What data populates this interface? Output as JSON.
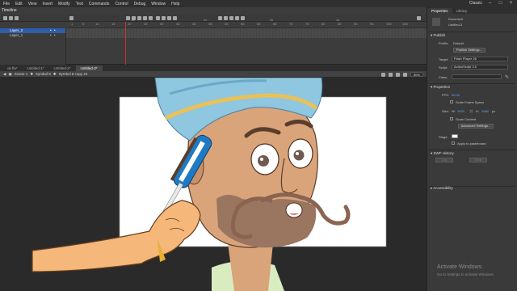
{
  "menu": {
    "items": [
      "File",
      "Edit",
      "View",
      "Insert",
      "Modify",
      "Text",
      "Commands",
      "Control",
      "Debug",
      "Window",
      "Help"
    ],
    "workspace": "Classic"
  },
  "timeline": {
    "title": "Timeline",
    "ruler_ticks": [
      "1",
      "5",
      "10",
      "15",
      "20",
      "25",
      "30",
      "35",
      "40",
      "45",
      "50",
      "55",
      "60",
      "65",
      "70",
      "75",
      "80",
      "85",
      "90",
      "95",
      "100",
      "105"
    ],
    "ruler_seconds": [
      "1s",
      "2s",
      "3s",
      "4s"
    ],
    "layers": [
      {
        "name": "Layer_2",
        "selected": true
      },
      {
        "name": "Layer_1",
        "selected": false
      }
    ],
    "current_frame": 23
  },
  "document_tabs": [
    "ok.fla*",
    "Untitled-1*",
    "Untitled-2*",
    "Untitled-3*"
  ],
  "active_tab_index": 3,
  "edit_bar": {
    "scene": "Scene 1",
    "symbol1": "Symbol 8",
    "symbol2": "Symbol 8 copy 22",
    "zoom": "50%"
  },
  "properties": {
    "tabs": [
      "Properties",
      "Library"
    ],
    "doc_type": "Document",
    "doc_name": "Untitled-3",
    "publish_section": "Publish",
    "profile_label": "Profile:",
    "profile_value": "Default",
    "publish_settings_button": "Publish Settings...",
    "target_label": "Target:",
    "target_value": "Flash Player 26",
    "script_label": "Script:",
    "script_value": "ActionScript 3.0",
    "class_label": "Class:",
    "props_section": "Properties",
    "fps_label": "FPS:",
    "fps_value": "30.00",
    "scale_frame_spans": "Scale Frame Spans",
    "size_label": "Size:",
    "size_w_label": "W:",
    "size_w": "1920",
    "size_h_label": "H:",
    "size_h": "1080",
    "size_unit": "px",
    "scale_content": "Scale Content",
    "advanced_settings": "Advanced Settings...",
    "stage_label": "Stage:",
    "apply_pasteboard": "Apply to pasteboard",
    "swf_history": "SWF History",
    "log_button": "Log",
    "clear_button": "Clear",
    "accessibility": "Accessibility"
  },
  "watermark": {
    "title": "Activate Windows",
    "subtitle": "Go to Settings to activate Windows."
  },
  "colors": {
    "selection": "#2e5ea8",
    "playhead": "#d03030",
    "turban": "#8fc6e0",
    "skin": "#d9a47a",
    "beard": "#9a7560",
    "hand": "#f5b77a",
    "comb": "#1e7ac4"
  }
}
